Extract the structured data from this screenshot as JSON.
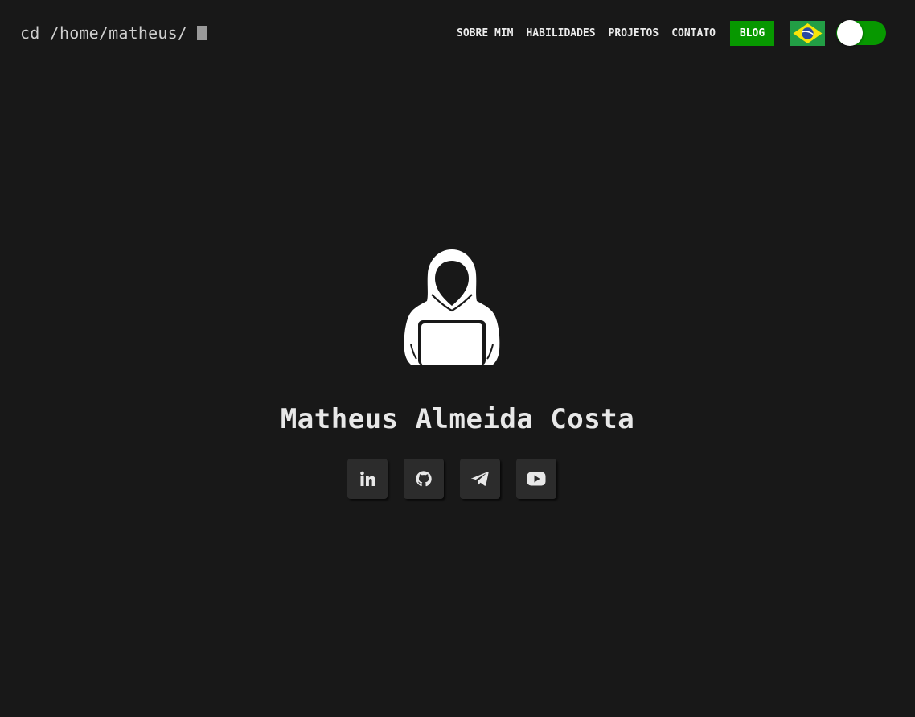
{
  "header": {
    "prompt": "cd /home/matheus/",
    "nav": {
      "about": "SOBRE MIM",
      "skills": "HABILIDADES",
      "projects": "PROJETOS",
      "contact": "CONTATO",
      "blog": "BLOG"
    },
    "language_flag_icon": "brazil-flag-icon",
    "theme_toggle_on": true
  },
  "hero": {
    "avatar_icon": "hooded-hacker-laptop-icon",
    "name": "Matheus Almeida Costa",
    "socials": [
      {
        "icon": "linkedin-icon"
      },
      {
        "icon": "github-icon"
      },
      {
        "icon": "telegram-icon"
      },
      {
        "icon": "youtube-icon"
      }
    ]
  },
  "colors": {
    "background": "#181818",
    "accent": "#079800",
    "button_bg": "#2c2c2c",
    "text": "#e8e8e8"
  }
}
